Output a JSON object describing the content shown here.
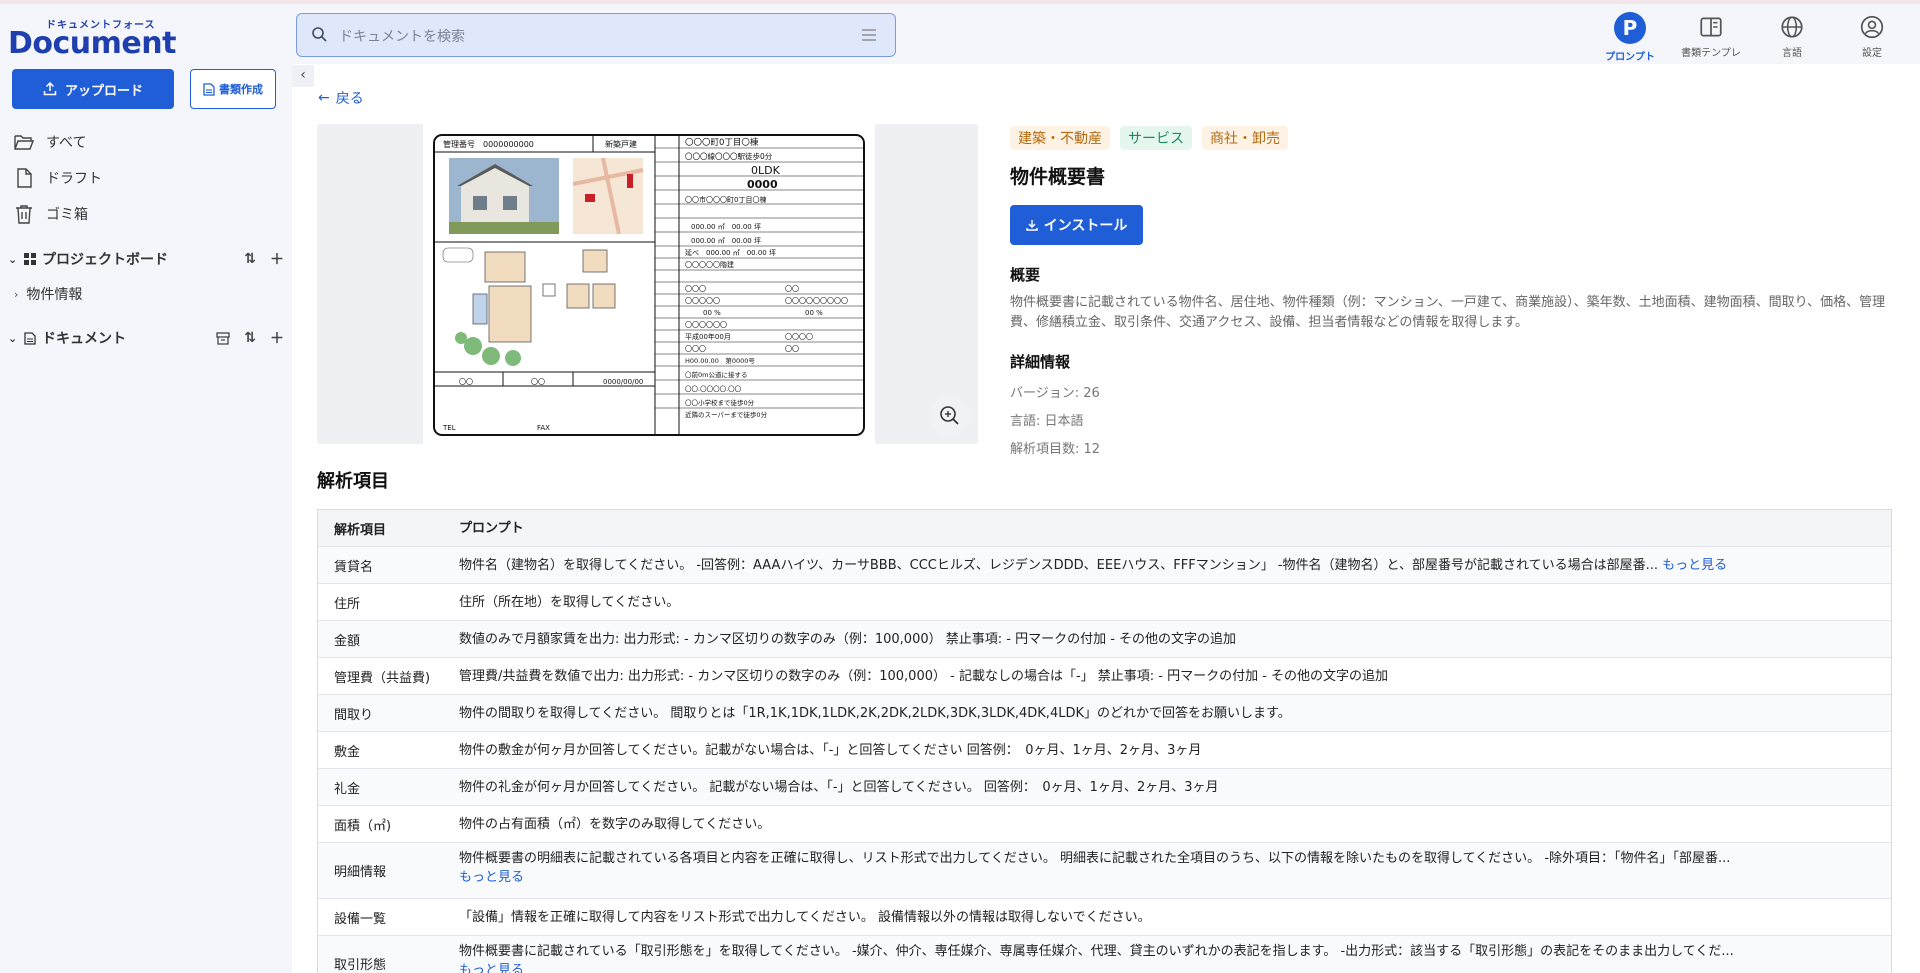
{
  "header": {
    "logo_kana": "ドキュメントフォース",
    "logo_main": "Document Force",
    "search_placeholder": "ドキュメントを検索",
    "nav": [
      {
        "label": "プロンプト",
        "icon": "prompt-p-icon",
        "active": true
      },
      {
        "label": "書類テンプレ",
        "icon": "template-book-icon",
        "active": false
      },
      {
        "label": "言語",
        "icon": "globe-icon",
        "active": false
      },
      {
        "label": "設定",
        "icon": "user-settings-icon",
        "active": false
      }
    ]
  },
  "sidebar": {
    "upload_label": "アップロード",
    "create_label": "書類作成",
    "links": [
      {
        "label": "すべて",
        "icon": "folder-open-icon"
      },
      {
        "label": "ドラフト",
        "icon": "file-icon"
      },
      {
        "label": "ゴミ箱",
        "icon": "trash-icon"
      }
    ],
    "project_board_label": "プロジェクトボード",
    "project_items": [
      {
        "label": "物件情報"
      }
    ],
    "documents_label": "ドキュメント"
  },
  "main": {
    "back_label": "戻る",
    "tags": [
      "建築・不動産",
      "サービス",
      "商社・卸売"
    ],
    "title": "物件概要書",
    "install_label": "インストール",
    "summary_heading": "概要",
    "summary_text": "物件概要書に記載されている物件名、居住地、物件種類（例：マンション、一戸建て、商業施設）、築年数、土地面積、建物面積、間取り、価格、管理費、修繕積立金、取引条件、交通アクセス、設備、担当者情報などの情報を取得します。",
    "detail_heading": "詳細情報",
    "details": [
      "バージョン: 26",
      "言語: 日本語",
      "解析項目数: 12"
    ],
    "items_heading": "解析項目",
    "more_label": "もっと見る",
    "table": {
      "headers": [
        "解析項目",
        "プロンプト"
      ],
      "rows": [
        {
          "item": "賃貸名",
          "prompt": "物件名（建物名）を取得してください。 -回答例：AAAハイツ、カーサBBB、CCCヒルズ、レジデンスDDD、EEEハウス、FFFマンション」 -物件名（建物名）と、部屋番号が記載されている場合は部屋番...",
          "more": true
        },
        {
          "item": "住所",
          "prompt": "住所（所在地）を取得してください。",
          "more": false
        },
        {
          "item": "金額",
          "prompt": "数値のみで月額家賃を出力: 出力形式: - カンマ区切りの数字のみ（例：100,000） 禁止事項: - 円マークの付加 - その他の文字の追加",
          "more": false
        },
        {
          "item": "管理費（共益費)",
          "prompt": "管理費/共益費を数値で出力: 出力形式: - カンマ区切りの数字のみ（例：100,000） - 記載なしの場合は「-」 禁止事項: - 円マークの付加 - その他の文字の追加",
          "more": false
        },
        {
          "item": "間取り",
          "prompt": "物件の間取りを取得してください。 間取りとは「1R,1K,1DK,1LDK,2K,2DK,2LDK,3DK,3LDK,4DK,4LDK」のどれかで回答をお願いします。",
          "more": false
        },
        {
          "item": "敷金",
          "prompt": "物件の敷金が何ヶ月か回答してください。記載がない場合は、「-」と回答してください 回答例：　0ヶ月、1ヶ月、2ヶ月、3ヶ月",
          "more": false
        },
        {
          "item": "礼金",
          "prompt": "物件の礼金が何ヶ月か回答してください。 記載がない場合は、「-」と回答してください。 回答例：　0ヶ月、1ヶ月、2ヶ月、3ヶ月",
          "more": false
        },
        {
          "item": "面積（㎡)",
          "prompt": "物件の占有面積（㎡）を数字のみ取得してください。",
          "more": false
        },
        {
          "item": "明細情報",
          "prompt": "物件概要書の明細表に記載されている各項目と内容を正確に取得し、リスト形式で出力してください。 明細表に記載された全項目のうち、以下の情報を除いたものを取得してください。 -除外項目：「物件名」「部屋番...",
          "more": true
        },
        {
          "item": "設備一覧",
          "prompt": "「設備」情報を正確に取得して内容をリスト形式で出力してください。 設備情報以外の情報は取得しないでください。",
          "more": false
        },
        {
          "item": "取引形態",
          "prompt": "物件概要書に記載されている「取引形態を」を取得してください。 -媒介、仲介、専任媒介、専属専任媒介、代理、貸主のいずれかの表記を指します。 -出力形式：該当する「取引形態」の表記をそのまま出力してくだ...",
          "more": true
        }
      ]
    }
  },
  "preview_doc": {
    "mgmt_no": "管理番号　0000000000",
    "kind": "新築戸建",
    "address": "〇〇〇町0丁目〇棟",
    "station": "〇〇〇線〇〇〇駅徒歩0分",
    "layout": "0LDK",
    "price": "0000",
    "location": "〇〇市〇〇〇町0丁目〇棟",
    "area1": "000.00 ㎡　00.00 坪",
    "area2": "000.00 ㎡　00.00 坪",
    "area3": "延べ　000.00 ㎡　00.00 坪",
    "structure": "〇〇〇〇〇階建",
    "misc": [
      "〇〇〇",
      "〇〇",
      "〇〇〇〇〇",
      "〇〇〇〇〇〇〇〇〇",
      "00 %",
      "00 %",
      "〇〇〇〇〇〇",
      "平成00年00月",
      "〇〇〇〇",
      "〇〇〇",
      "〇〇",
      "H00.00.00　第0000号",
      "〇前0m公道に接する",
      "〇〇.〇〇〇〇.〇〇",
      "〇〇小学校まで徒歩0分",
      "近隣のスーパーまで徒歩0分"
    ],
    "footer_tel": "TEL",
    "footer_fax": "FAX",
    "footer_date": "0000/00/00",
    "footer_vals": [
      "〇〇",
      "〇〇"
    ]
  }
}
